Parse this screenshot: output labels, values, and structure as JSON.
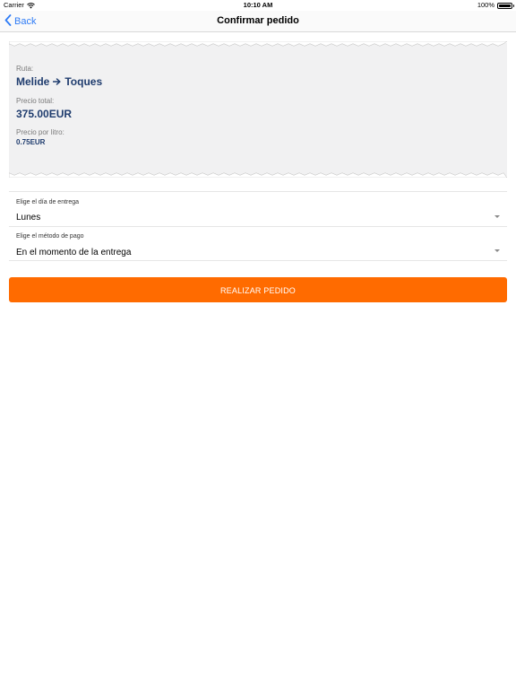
{
  "status_bar": {
    "carrier": "Carrier",
    "time": "10:10 AM",
    "battery": "100%",
    "battery_level": 1.0
  },
  "nav": {
    "back_label": "Back",
    "title": "Confirmar pedido"
  },
  "receipt": {
    "route_label": "Ruta:",
    "route_from": "Melide",
    "route_to": "Toques",
    "total_label": "Precio total:",
    "total_value": "375.00EUR",
    "per_liter_label": "Precio por litro:",
    "per_liter_value": "0.75EUR",
    "background_color": "#f1f1f2",
    "text_color": "#1f3c6e"
  },
  "delivery_day": {
    "label": "Elige el día de entrega",
    "value": "Lunes"
  },
  "payment_method": {
    "label": "Elige el método de pago",
    "value": "En el momento de la entrega"
  },
  "order_button": {
    "label": "REALIZAR PEDIDO",
    "color": "#ff6b00"
  },
  "icons": {
    "back": "chevron-left-icon",
    "arrow": "arrow-right-icon",
    "wifi": "wifi-icon",
    "battery": "battery-icon",
    "dropdown": "dropdown-caret-icon"
  }
}
